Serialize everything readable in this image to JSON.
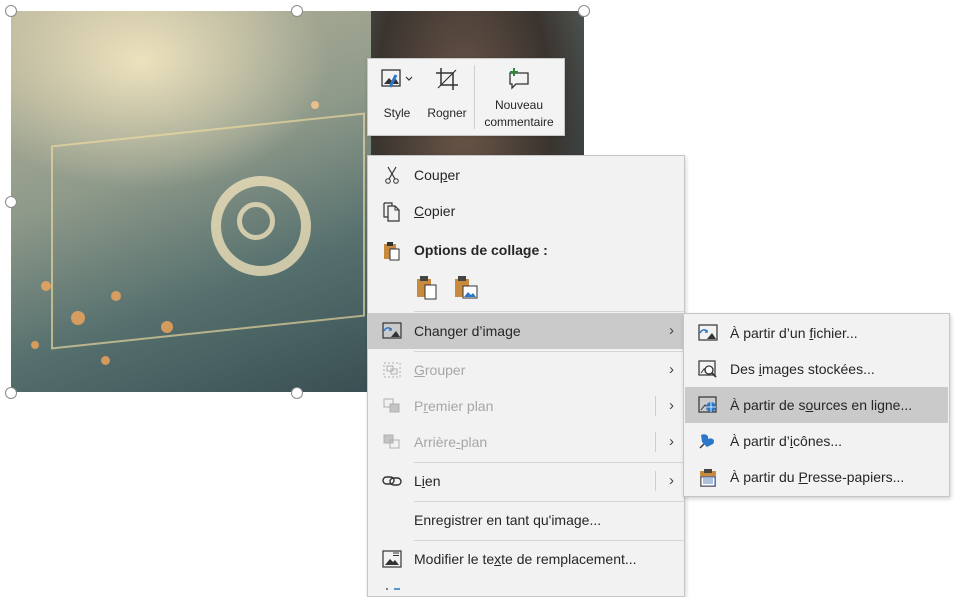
{
  "mini_toolbar": {
    "style_label": "Style",
    "crop_label": "Rogner",
    "comment_line1": "Nouveau",
    "comment_line2": "commentaire"
  },
  "context_menu": {
    "cut": {
      "before": "Cou",
      "key": "p",
      "after": "er"
    },
    "copy": {
      "before": "",
      "key": "C",
      "after": "opier"
    },
    "paste_options": "Options de collage :",
    "change_image": {
      "before": "Changer d’ima",
      "key": "g",
      "after": "e"
    },
    "group": {
      "before": "",
      "key": "G",
      "after": "rouper"
    },
    "bring_front": {
      "before": "P",
      "key": "r",
      "after": "emier plan"
    },
    "send_back": {
      "before": "Arrière",
      "key": "-",
      "after": "plan"
    },
    "link": {
      "before": "L",
      "key": "i",
      "after": "en"
    },
    "save_as_image": {
      "before": "Enre",
      "key": "g",
      "after": "istrer en tant qu'image..."
    },
    "alt_text": {
      "before": "Modifier le te",
      "key": "x",
      "after": "te de remplacement..."
    }
  },
  "submenu": {
    "from_file": {
      "before": "À partir d’un ",
      "key": "f",
      "after": "ichier..."
    },
    "stock_images": {
      "before": "Des ",
      "key": "i",
      "after": "mages stockées..."
    },
    "online": {
      "before": "À partir de s",
      "key": "o",
      "after": "urces en ligne..."
    },
    "icons": {
      "before": "À partir d’",
      "key": "i",
      "after": "cônes..."
    },
    "clipboard": {
      "before": "À partir du ",
      "key": "P",
      "after": "resse-papiers..."
    }
  },
  "colors": {
    "menu_bg": "#f2f2f2",
    "highlight": "#cacaca",
    "disabled_text": "#a6a6a6"
  }
}
